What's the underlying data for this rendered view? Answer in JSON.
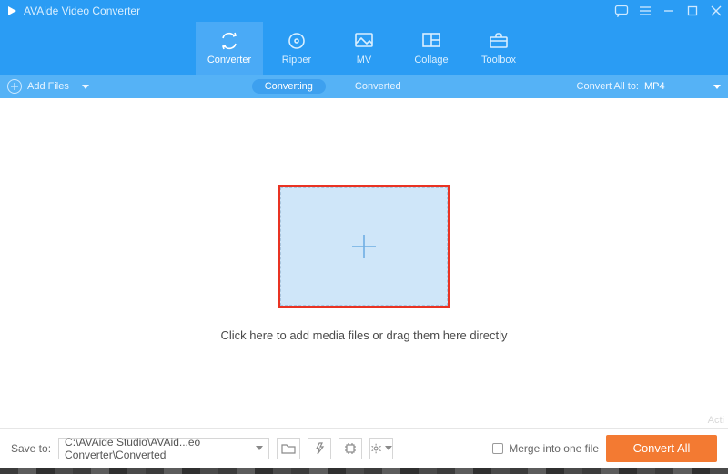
{
  "app": {
    "title": "AVAide Video Converter"
  },
  "nav": {
    "items": [
      {
        "label": "Converter"
      },
      {
        "label": "Ripper"
      },
      {
        "label": "MV"
      },
      {
        "label": "Collage"
      },
      {
        "label": "Toolbox"
      }
    ]
  },
  "subbar": {
    "add_files": "Add Files",
    "tab_converting": "Converting",
    "tab_converted": "Converted",
    "convert_all_to_label": "Convert All to:",
    "convert_all_to_value": "MP4"
  },
  "main": {
    "hint": "Click here to add media files or drag them here directly"
  },
  "bottom": {
    "save_to_label": "Save to:",
    "path": "C:\\AVAide Studio\\AVAid...eo Converter\\Converted",
    "merge_label": "Merge into one file",
    "convert_all": "Convert All"
  },
  "watermark": "Acti"
}
